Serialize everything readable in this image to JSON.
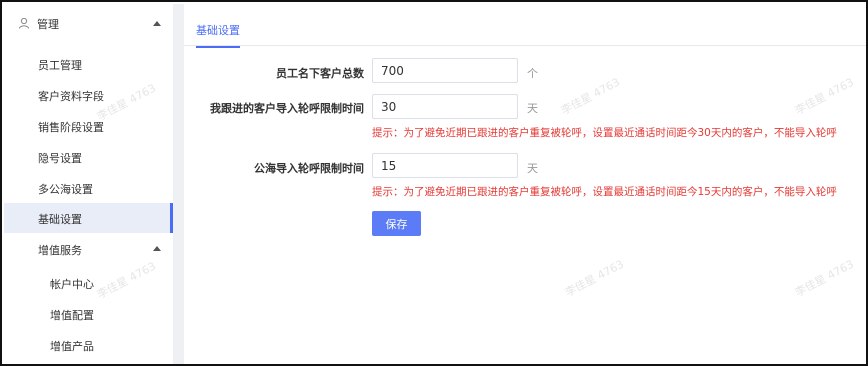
{
  "sidebar": {
    "header": {
      "title": "管理"
    },
    "items": [
      {
        "label": "员工管理"
      },
      {
        "label": "客户资料字段"
      },
      {
        "label": "销售阶段设置"
      },
      {
        "label": "隐号设置"
      },
      {
        "label": "多公海设置"
      },
      {
        "label": "基础设置",
        "active": true
      }
    ],
    "group": {
      "title": "增值服务",
      "items": [
        {
          "label": "帐户中心"
        },
        {
          "label": "增值配置"
        },
        {
          "label": "增值产品"
        }
      ]
    }
  },
  "main": {
    "tab": "基础设置",
    "fields": [
      {
        "label": "员工名下客户总数",
        "value": "700",
        "unit": "个",
        "hint": ""
      },
      {
        "label": "我跟进的客户导入轮呼限制时间",
        "value": "30",
        "unit": "天",
        "hint": "提示：为了避免近期已跟进的客户重复被轮呼，设置最近通话时间距今30天内的客户，不能导入轮呼"
      },
      {
        "label": "公海导入轮呼限制时间",
        "value": "15",
        "unit": "天",
        "hint": "提示：为了避免近期已跟进的客户重复被轮呼，设置最近通话时间距今15天内的客户，不能导入轮呼"
      }
    ],
    "save_label": "保存"
  },
  "watermark": "李佳星 4763",
  "colors": {
    "accent": "#4a6cf7",
    "hint": "#e53935",
    "button": "#5b7cf6",
    "divider": "#eef0f4"
  }
}
